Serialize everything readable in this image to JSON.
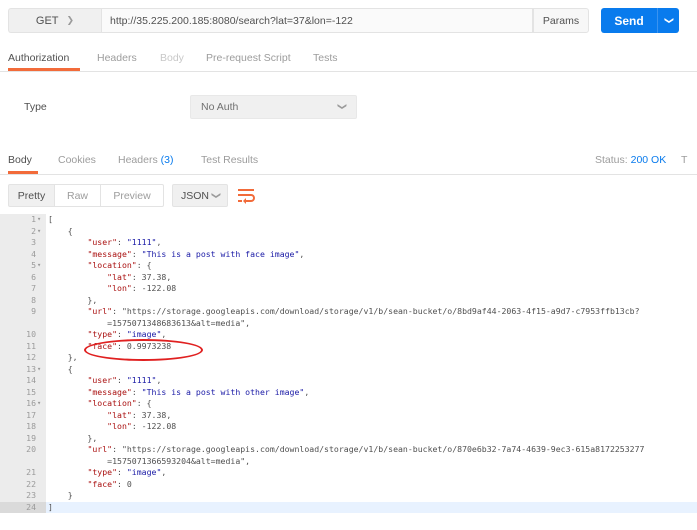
{
  "request": {
    "method": "GET",
    "url": "http://35.225.200.185:8080/search?lat=37&lon=-122",
    "params_label": "Params",
    "send_label": "Send"
  },
  "request_tabs": [
    "Authorization",
    "Headers",
    "Body",
    "Pre-request Script",
    "Tests"
  ],
  "auth": {
    "type_label": "Type",
    "type_value": "No Auth"
  },
  "response_tabs": {
    "body": "Body",
    "cookies": "Cookies",
    "headers": "Headers",
    "headers_count": "(3)",
    "tests": "Test Results"
  },
  "status": {
    "label": "Status:",
    "value": "200 OK",
    "trunc": "T"
  },
  "view_modes": [
    "Pretty",
    "Raw",
    "Preview"
  ],
  "format": "JSON",
  "code_lines": [
    {
      "n": "1",
      "fold": "▾",
      "text": "["
    },
    {
      "n": "2",
      "fold": "▾",
      "text": "    {"
    },
    {
      "n": "3",
      "fold": "",
      "text": "        \"user\": \"1111\","
    },
    {
      "n": "4",
      "fold": "",
      "text": "        \"message\": \"This is a post with face image\","
    },
    {
      "n": "5",
      "fold": "▾",
      "text": "        \"location\": {"
    },
    {
      "n": "6",
      "fold": "",
      "text": "            \"lat\": 37.38,"
    },
    {
      "n": "7",
      "fold": "",
      "text": "            \"lon\": -122.08"
    },
    {
      "n": "8",
      "fold": "",
      "text": "        },"
    },
    {
      "n": "9",
      "fold": "",
      "text": "        \"url\": \"https://storage.googleapis.com/download/storage/v1/b/sean-bucket/o/8bd9af44-2063-4f15-a9d7-c7953ffb13cb?"
    },
    {
      "n": "",
      "fold": "",
      "text": "            =1575071348683613&alt=media\","
    },
    {
      "n": "10",
      "fold": "",
      "text": "        \"type\": \"image\","
    },
    {
      "n": "11",
      "fold": "",
      "text": "        \"face\": 0.9973238"
    },
    {
      "n": "12",
      "fold": "",
      "text": "    },"
    },
    {
      "n": "13",
      "fold": "▾",
      "text": "    {"
    },
    {
      "n": "14",
      "fold": "",
      "text": "        \"user\": \"1111\","
    },
    {
      "n": "15",
      "fold": "",
      "text": "        \"message\": \"This is a post with other image\","
    },
    {
      "n": "16",
      "fold": "▾",
      "text": "        \"location\": {"
    },
    {
      "n": "17",
      "fold": "",
      "text": "            \"lat\": 37.38,"
    },
    {
      "n": "18",
      "fold": "",
      "text": "            \"lon\": -122.08"
    },
    {
      "n": "19",
      "fold": "",
      "text": "        },"
    },
    {
      "n": "20",
      "fold": "",
      "text": "        \"url\": \"https://storage.googleapis.com/download/storage/v1/b/sean-bucket/o/870e6b32-7a74-4639-9ec3-615a8172253277"
    },
    {
      "n": "",
      "fold": "",
      "text": "            =1575071366593204&alt=media\","
    },
    {
      "n": "21",
      "fold": "",
      "text": "        \"type\": \"image\","
    },
    {
      "n": "22",
      "fold": "",
      "text": "        \"face\": 0"
    },
    {
      "n": "23",
      "fold": "",
      "text": "    }"
    },
    {
      "n": "24",
      "fold": "",
      "text": "]",
      "active": true
    }
  ],
  "colors": {
    "accent": "#097bed",
    "tab_underline": "#f26b3a",
    "annotation": "#e02020",
    "wrap_icon": "#f26b3a"
  },
  "icons": {
    "method_dropdown": "chevron-down-icon",
    "send_dropdown": "chevron-down-icon",
    "format_dropdown": "chevron-down-icon",
    "wrap": "wrap-lines-icon",
    "fold": "fold-caret-icon"
  }
}
